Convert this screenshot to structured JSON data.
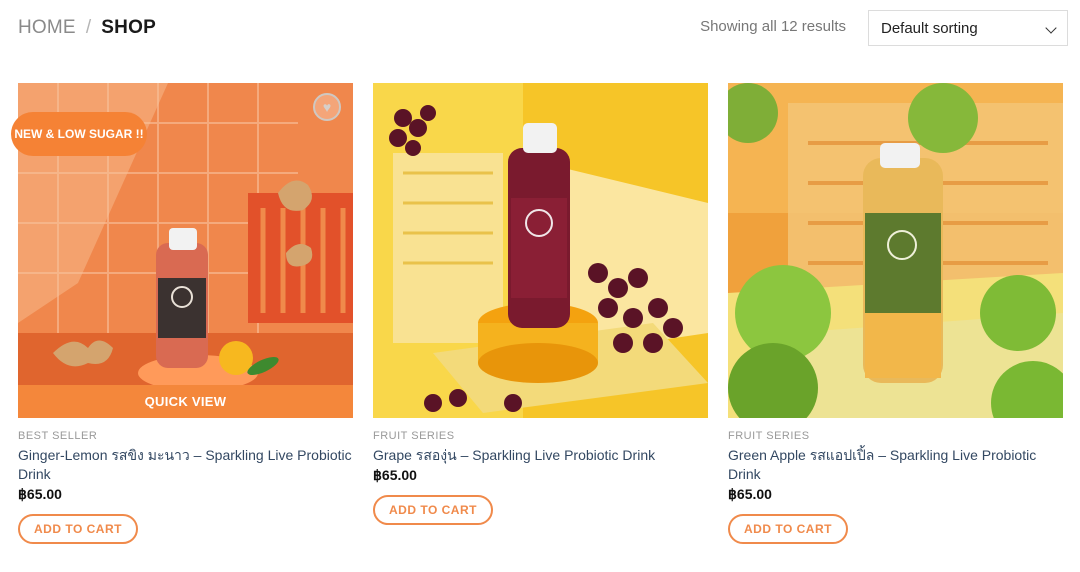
{
  "breadcrumb": {
    "home": "HOME",
    "separator": "/",
    "current": "SHOP"
  },
  "results": {
    "text": "Showing all 12 results"
  },
  "sorting": {
    "selected": "Default sorting"
  },
  "products": [
    {
      "badge": "NEW & LOW SUGAR !!",
      "quick_view": "QUICK VIEW",
      "category": "BEST SELLER",
      "title": "Ginger-Lemon รสขิง มะนาว – Sparkling Live Probiotic Drink",
      "price": "฿65.00",
      "cta": "ADD TO CART"
    },
    {
      "category": "FRUIT SERIES",
      "title": "Grape รสองุ่น – Sparkling Live Probiotic Drink",
      "price": "฿65.00",
      "cta": "ADD TO CART"
    },
    {
      "category": "FRUIT SERIES",
      "title": "Green Apple รสแอปเปิ้ล – Sparkling Live Probiotic Drink",
      "price": "฿65.00",
      "cta": "ADD TO CART"
    }
  ],
  "colors": {
    "accent": "#f08a4b",
    "title_link": "#334862",
    "badge": "#f58235"
  }
}
